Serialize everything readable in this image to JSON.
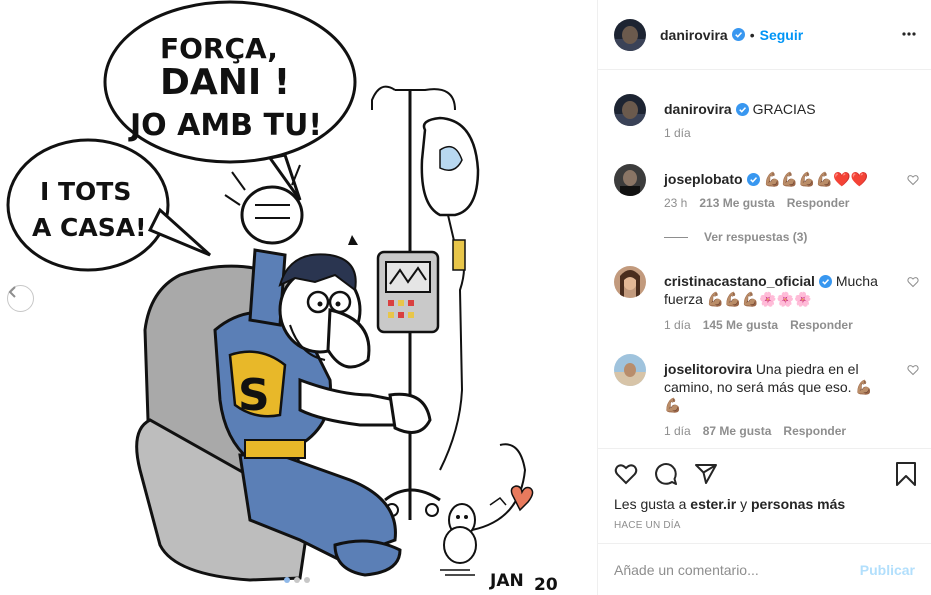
{
  "post": {
    "author": "danirovira",
    "follow_sep": "•",
    "follow_label": "Seguir",
    "caption": "GRACIAS",
    "caption_time": "1 día"
  },
  "cartoon": {
    "bubble1_line1": "FORÇA,",
    "bubble1_line2": "DANI !",
    "bubble1_line3": "JO AMB TU!",
    "bubble2_line1": "I TOTS",
    "bubble2_line2": "A CASA!",
    "shirt_letter": "S",
    "signature": "JAN",
    "signature_year": "20"
  },
  "carousel": {
    "slides": 3,
    "active": 0
  },
  "comments": [
    {
      "user": "joseplobato",
      "verified": true,
      "text": "💪🏽💪🏽💪🏽💪🏽❤️❤️",
      "time": "23 h",
      "likes": "213 Me gusta",
      "reply": "Responder"
    },
    {
      "user": "cristinacastano_oficial",
      "verified": true,
      "text": "Mucha fuerza 💪🏽💪🏽💪🏽🌸🌸🌸",
      "time": "1 día",
      "likes": "145 Me gusta",
      "reply": "Responder"
    },
    {
      "user": "joselitorovira",
      "verified": false,
      "text": "Una piedra en el camino, no será más que eso. 💪🏽💪🏽",
      "time": "1 día",
      "likes": "87 Me gusta",
      "reply": "Responder"
    }
  ],
  "view_replies": "Ver respuestas (3)",
  "likes_line": {
    "prefix": "Les gusta a",
    "user": "ester.ir",
    "mid": "y",
    "rest": "personas más"
  },
  "time_ago": "HACE UN DÍA",
  "add_comment": {
    "placeholder": "Añade un comentario...",
    "publish": "Publicar"
  },
  "icons": {
    "verified": "verified-badge-icon",
    "more": "more-options-icon",
    "like": "heart-icon",
    "comment": "comment-icon",
    "share": "share-icon",
    "save": "bookmark-icon",
    "prev": "chevron-left-icon"
  },
  "colors": {
    "accent": "#0095f6",
    "muted": "#8e8e8e",
    "publish_disabled": "#b2dffc",
    "verified": "#3897f0"
  }
}
